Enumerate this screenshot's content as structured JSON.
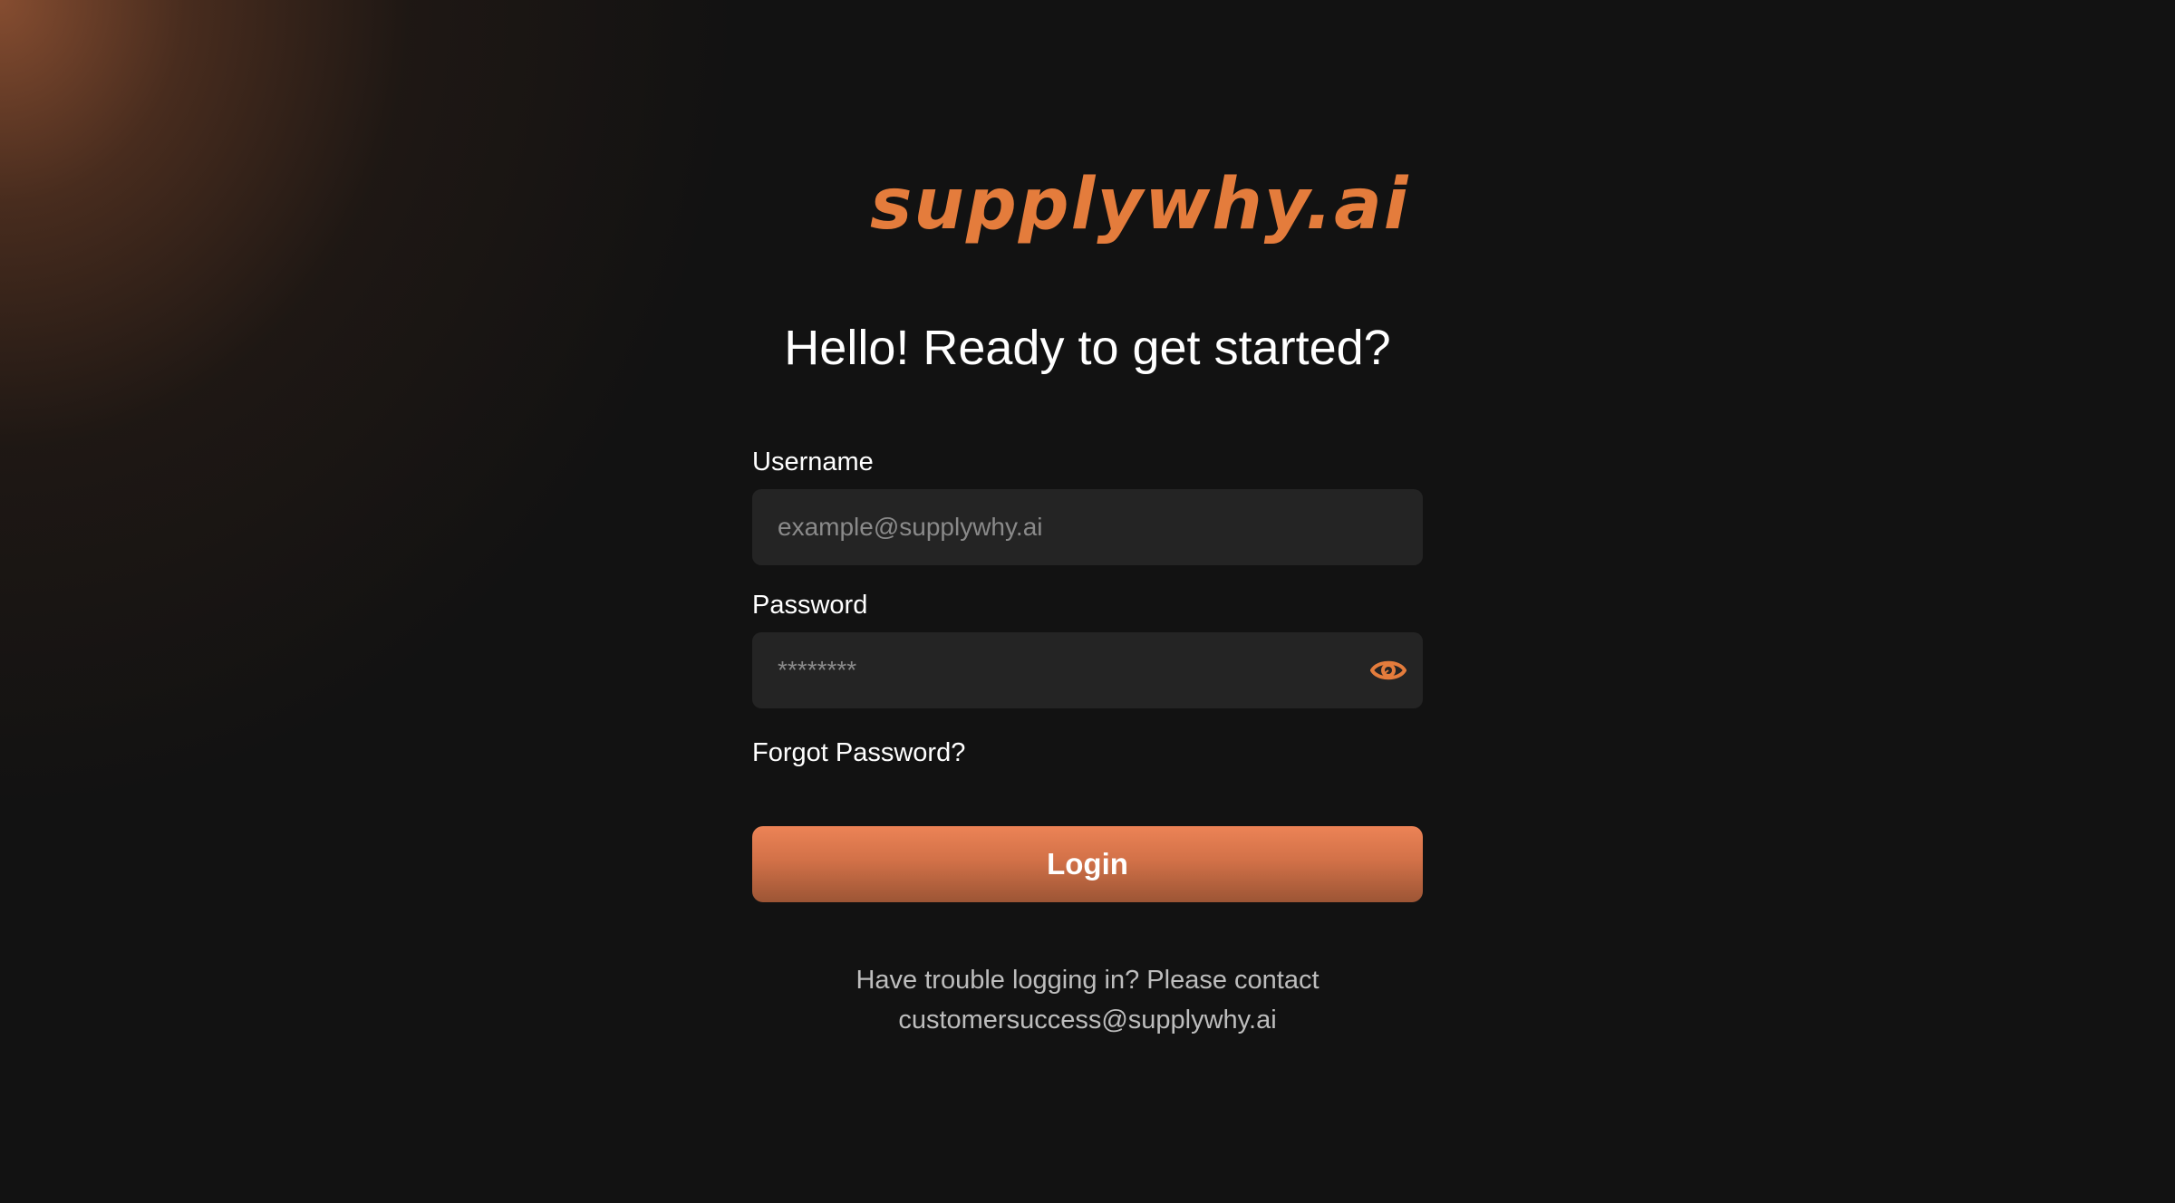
{
  "brand": {
    "logo_text": "supplywhy.ai",
    "accent_color": "#e47c3c"
  },
  "headline": "Hello! Ready to get started?",
  "username": {
    "label": "Username",
    "placeholder": "example@supplywhy.ai",
    "value": ""
  },
  "password": {
    "label": "Password",
    "placeholder": "********",
    "value": "",
    "toggle_icon": "eye-icon"
  },
  "forgot_password": "Forgot Password?",
  "login_button": "Login",
  "help": {
    "line1": "Have trouble logging in? Please contact",
    "line2": "customersuccess@supplywhy.ai"
  }
}
